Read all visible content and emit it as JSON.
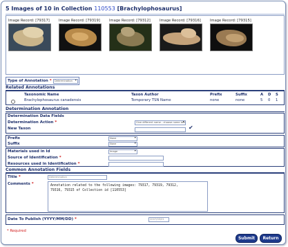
{
  "header": {
    "prefix": "5 Images of 10 in Collection",
    "collection_id": "110553",
    "taxon": "[Brachylophosaurus]"
  },
  "thumbnails": [
    {
      "caption": "Image Record: [79317]"
    },
    {
      "caption": "Image Record: [79319]"
    },
    {
      "caption": "Image Record: [79312]"
    },
    {
      "caption": "Image Record: [79316]"
    },
    {
      "caption": "Image Record: [79315]"
    }
  ],
  "type_of_annotation": {
    "label": "Type of Annotation",
    "required_mark": "*",
    "value": "Determination"
  },
  "related": {
    "heading": "Related Annotations",
    "columns": {
      "name": "Taxonomic Name",
      "author": "Taxon Author",
      "prefix": "Prefix",
      "suffix": "Suffix",
      "a": "A",
      "d": "D",
      "s": "S"
    },
    "rows": [
      {
        "name": "Brachylophosaurus canadensis",
        "author": "Temporary TSN Name",
        "prefix": "none",
        "suffix": "none",
        "a": "5",
        "d": "0",
        "s": "1"
      }
    ]
  },
  "determination": {
    "heading": "Determination Annotation",
    "data_fields": "Determination Data Fields",
    "action_label": "Determination Action",
    "action_value": "Give different name - choose name below",
    "new_taxon_label": "New Taxon",
    "new_taxon_value": "",
    "prefix_label": "Prefix",
    "prefix_value": "None",
    "suffix_label": "Suffix",
    "suffix_value": "None",
    "materials_label": "Materials used in Id",
    "materials_value": "Image",
    "source_label": "Source of Identification",
    "source_value": "",
    "resources_label": "Resources used in Identification",
    "resources_value": ""
  },
  "common": {
    "heading": "Common Annotation Fields",
    "title_label": "Title",
    "title_value": "Determination",
    "comments_label": "Comments",
    "comments_value": "Annotation related to the following images: 79317, 79319, 79312,\n79316, 79315 of Collection id [110553]",
    "date_label": "Date To Publish (YYYY/MM/DD)",
    "date_value": "2007/05/01"
  },
  "required_note": "* Required",
  "buttons": {
    "submit": "Submit",
    "return": "Return"
  },
  "colors": {
    "accent": "#1e3a8c",
    "required": "#d01818",
    "border": "#2a3f7a"
  }
}
